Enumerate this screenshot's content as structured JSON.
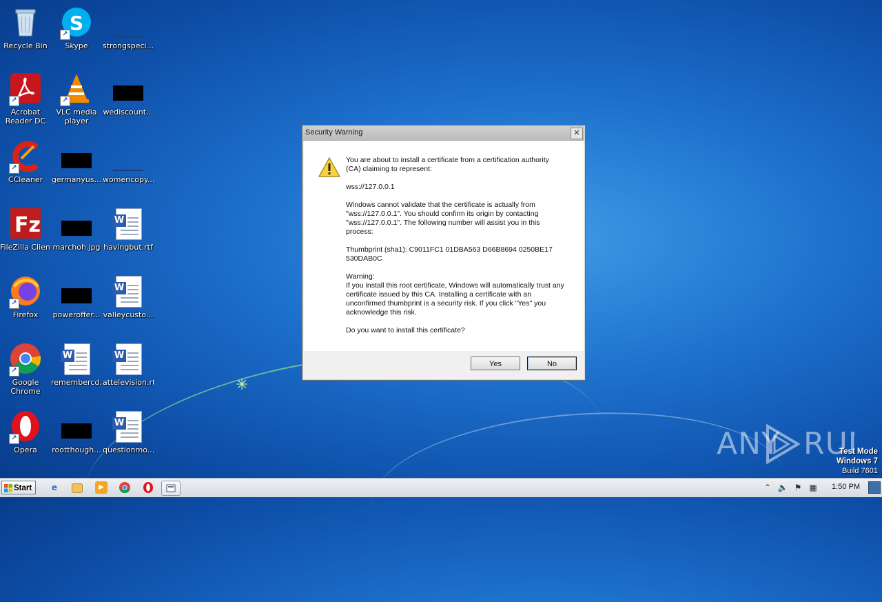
{
  "desktop": {
    "icons": [
      {
        "label": "Recycle Bin",
        "icon": "recycle-bin-icon"
      },
      {
        "label": "Skype",
        "icon": "skype-icon"
      },
      {
        "label": "strongspeci...",
        "icon": "file-thumbnail-icon"
      },
      {
        "label": "Acrobat Reader DC",
        "icon": "acrobat-icon"
      },
      {
        "label": "VLC media player",
        "icon": "vlc-icon"
      },
      {
        "label": "wediscount...",
        "icon": "image-file-icon"
      },
      {
        "label": "CCleaner",
        "icon": "ccleaner-icon"
      },
      {
        "label": "germanyus...",
        "icon": "image-file-icon"
      },
      {
        "label": "womencopy...",
        "icon": "file-thumbnail-icon"
      },
      {
        "label": "FileZilla Client",
        "icon": "filezilla-icon"
      },
      {
        "label": "marchoh.jpg",
        "icon": "image-file-icon"
      },
      {
        "label": "havingbut.rtf",
        "icon": "word-doc-icon"
      },
      {
        "label": "Firefox",
        "icon": "firefox-icon"
      },
      {
        "label": "poweroffer...",
        "icon": "image-file-icon"
      },
      {
        "label": "valleycusto...",
        "icon": "word-doc-icon"
      },
      {
        "label": "Google Chrome",
        "icon": "chrome-icon"
      },
      {
        "label": "remembercd...",
        "icon": "word-doc-icon"
      },
      {
        "label": "attelevision.rtf",
        "icon": "word-doc-icon"
      },
      {
        "label": "Opera",
        "icon": "opera-icon"
      },
      {
        "label": "rootthough...",
        "icon": "image-file-icon"
      },
      {
        "label": "questionmo...",
        "icon": "word-doc-icon"
      }
    ]
  },
  "dialog": {
    "title": "Security Warning",
    "close": "✕",
    "p1": "You are about to install a certificate from a certification authority (CA) claiming to represent:",
    "p2": "wss://127.0.0.1",
    "p3": "Windows cannot validate that the certificate is actually from \"wss://127.0.0.1\". You should confirm its origin by contacting \"wss://127.0.0.1\". The following number will assist you in this process:",
    "p4": "Thumbprint (sha1): C9011FC1 01DBA563 D66B8694 0250BE17 530DAB0C",
    "p5_head": "Warning:",
    "p5": "If you install this root certificate, Windows will automatically trust any certificate issued by this CA. Installing a certificate with an unconfirmed thumbprint is a security risk. If you click \"Yes\" you acknowledge this risk.",
    "p6": "Do you want to install this certificate?",
    "yes": "Yes",
    "no": "No"
  },
  "watermark": {
    "text": "ANY RUN"
  },
  "testmode": {
    "line1": "Test Mode",
    "line2": "Windows 7",
    "line3": "Build 7601"
  },
  "taskbar": {
    "start": "Start",
    "clock": "1:50 PM",
    "pinned": [
      "internet-explorer-icon",
      "explorer-folder-icon",
      "media-player-icon",
      "chrome-icon",
      "opera-icon",
      "certificate-window-icon"
    ]
  }
}
